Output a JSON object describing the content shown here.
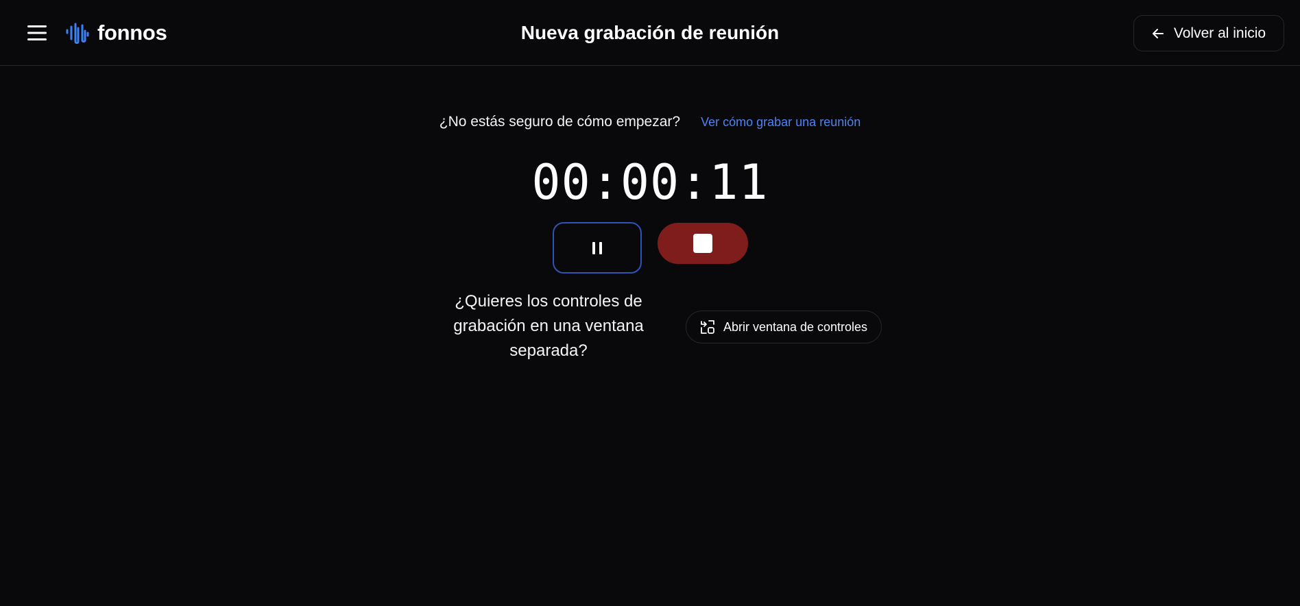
{
  "header": {
    "menu_icon": "hamburger-menu-icon",
    "logo_icon": "sound-wave-icon",
    "logo_text": "fonnos",
    "title": "Nueva grabación de reunión",
    "back_label": "Volver al inicio",
    "back_icon": "arrow-left-icon"
  },
  "help": {
    "question": "¿No estás seguro de cómo empezar?",
    "link_label": "Ver cómo grabar una reunión"
  },
  "recording": {
    "timer": "00:00:11",
    "pause_icon": "pause-icon",
    "stop_icon": "stop-icon"
  },
  "separate_window": {
    "question": "¿Quieres los controles de grabación en una ventana separada?",
    "button_label": "Abrir ventana de controles",
    "button_icon": "switch-window-icon"
  },
  "colors": {
    "background": "#09090b",
    "accent_blue": "#4d83f5",
    "pause_border": "#2f54b7",
    "stop_red": "#7f1d1d"
  }
}
